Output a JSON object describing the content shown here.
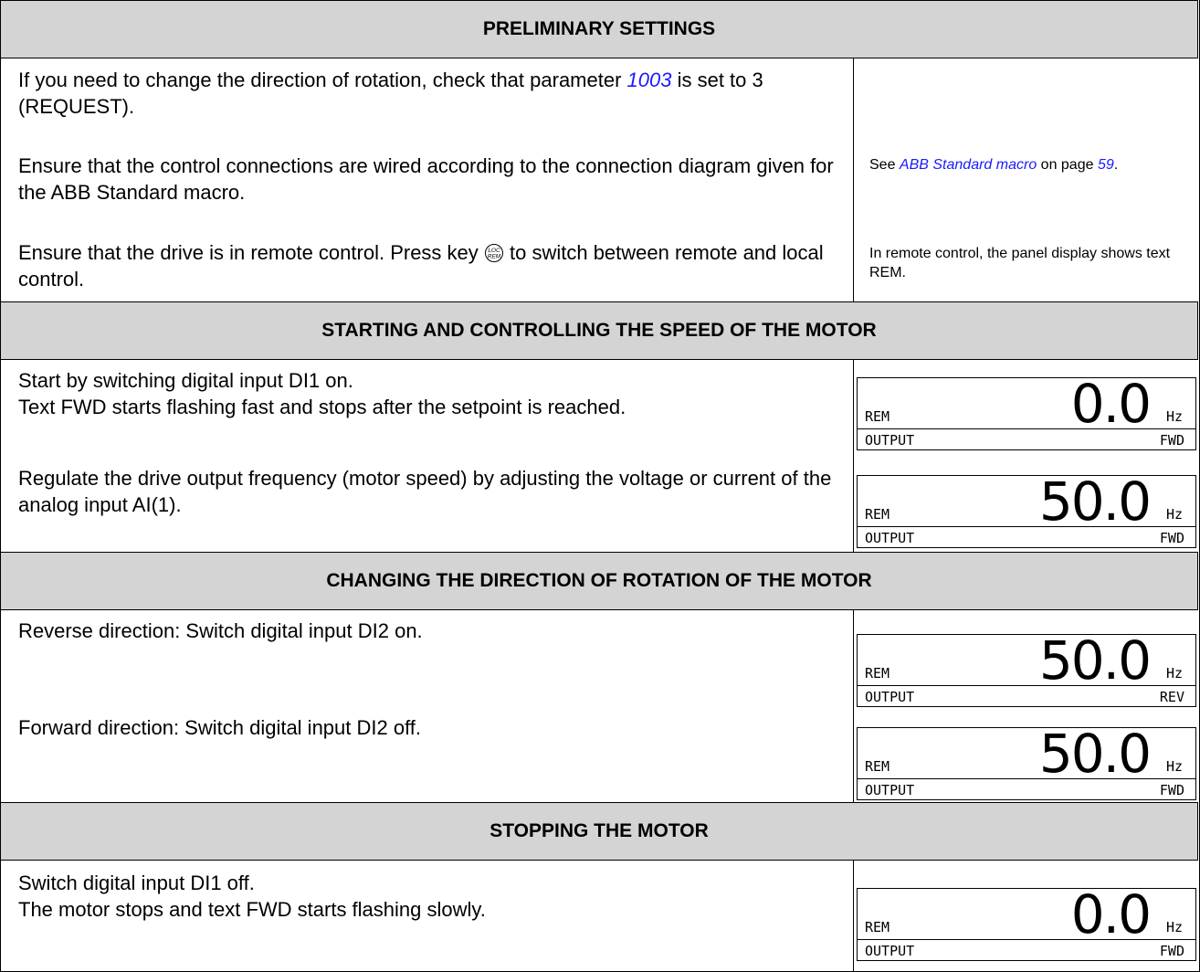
{
  "sections": {
    "preliminary": {
      "title": "PRELIMINARY SETTINGS",
      "rows": [
        {
          "text_before": "If you need to change the direction of rotation, check that parameter ",
          "link": "1003",
          "text_after": " is set to 3 (REQUEST)."
        },
        {
          "text": "Ensure that the control connections are wired according to the connection diagram given for the ABB Standard macro.",
          "note_before": "See ",
          "note_link": "ABB Standard macro",
          "note_mid": " on page ",
          "note_page": "59",
          "note_after": "."
        },
        {
          "text_before": "Ensure that the drive is in remote control. Press key ",
          "key_icon": "loc-rem-key-icon",
          "text_after": " to switch between remote and local control.",
          "note": "In remote control, the panel display shows text REM."
        }
      ]
    },
    "starting": {
      "title": "STARTING AND CONTROLLING THE SPEED OF THE MOTOR",
      "rows": [
        {
          "line1": "Start by switching digital input DI1 on.",
          "line2": "Text FWD starts flashing fast and stops after the setpoint is reached."
        },
        {
          "text": "Regulate the drive output frequency (motor speed) by adjusting the voltage or current of the analog input AI(1)."
        }
      ]
    },
    "direction": {
      "title": "CHANGING THE DIRECTION OF ROTATION OF THE MOTOR",
      "rows": [
        {
          "text": "Reverse direction: Switch digital input DI2 on."
        },
        {
          "text": "Forward direction: Switch digital input DI2 off."
        }
      ]
    },
    "stopping": {
      "title": "STOPPING THE MOTOR",
      "rows": [
        {
          "line1": "Switch digital input DI1 off.",
          "line2": "The motor stops and text FWD starts flashing slowly."
        }
      ]
    }
  },
  "panels": [
    {
      "mode": "REM",
      "value": "0.0",
      "unit": "Hz",
      "signal": "OUTPUT",
      "direction": "FWD"
    },
    {
      "mode": "REM",
      "value": "50.0",
      "unit": "Hz",
      "signal": "OUTPUT",
      "direction": "FWD"
    },
    {
      "mode": "REM",
      "value": "50.0",
      "unit": "Hz",
      "signal": "OUTPUT",
      "direction": "REV"
    },
    {
      "mode": "REM",
      "value": "50.0",
      "unit": "Hz",
      "signal": "OUTPUT",
      "direction": "FWD"
    },
    {
      "mode": "REM",
      "value": "0.0",
      "unit": "Hz",
      "signal": "OUTPUT",
      "direction": "FWD"
    }
  ],
  "colors": {
    "header_bg": "#d4d4d4",
    "link": "#1a1aff",
    "border": "#000000"
  }
}
